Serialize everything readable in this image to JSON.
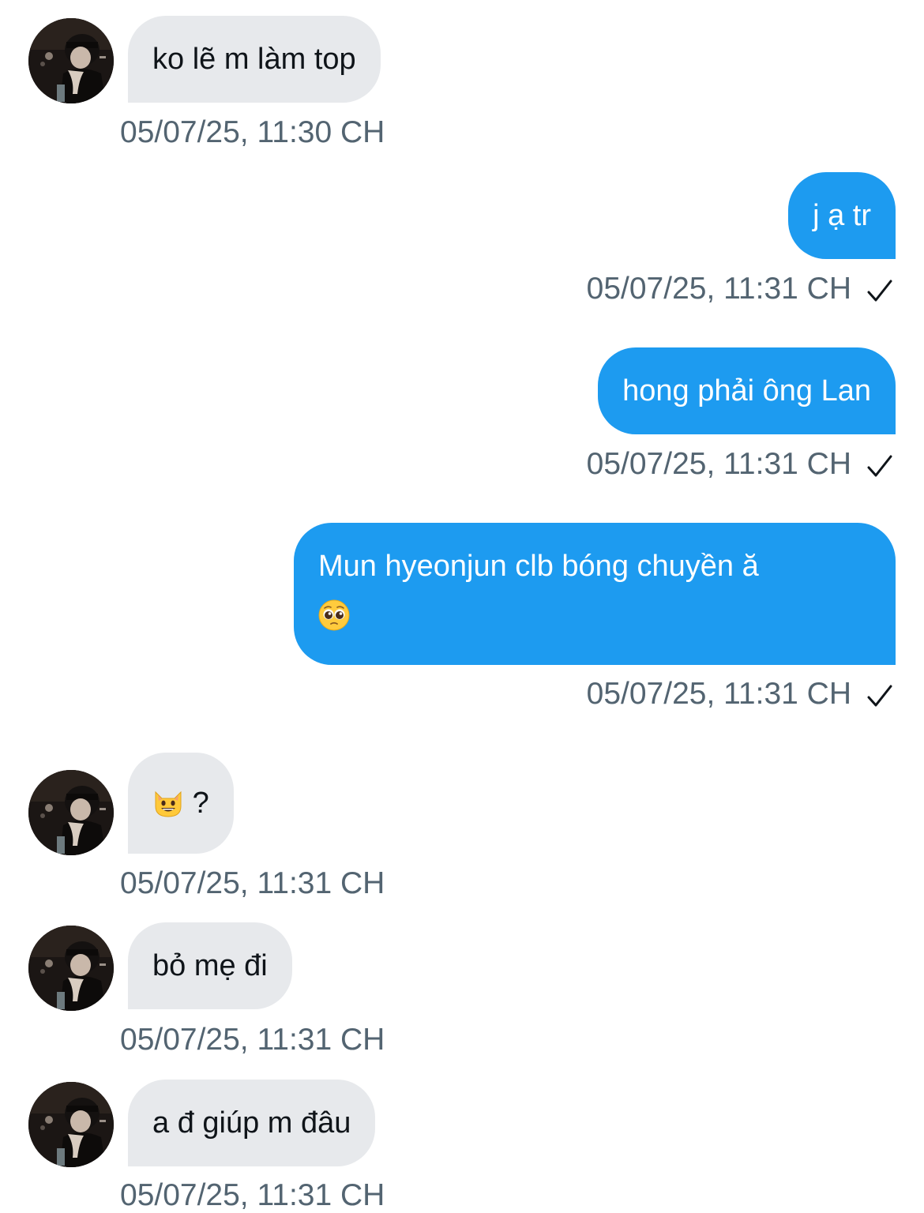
{
  "theme": {
    "incoming_bubble": "#e7e9ec",
    "outgoing_bubble": "#1d9bf0",
    "timestamp_color": "#536471"
  },
  "messages": [
    {
      "direction": "incoming",
      "text": "ko lẽ m làm top",
      "time": "05/07/25, 11:30 CH",
      "avatar": "user-avatar"
    },
    {
      "direction": "outgoing",
      "text": "j ạ tr",
      "time": "05/07/25, 11:31 CH",
      "status_icon": "check-icon"
    },
    {
      "direction": "outgoing",
      "text": "hong phải ông Lan",
      "time": "05/07/25, 11:31 CH",
      "status_icon": "check-icon"
    },
    {
      "direction": "outgoing",
      "text": "Mun hyeonjun clb bóng chuyền ă",
      "emoji": "pleading-face-emoji",
      "time": "05/07/25, 11:31 CH",
      "status_icon": "check-icon"
    },
    {
      "direction": "incoming",
      "emoji": "grinning-cat-emoji",
      "text": "?",
      "time": "05/07/25, 11:31 CH",
      "avatar": "user-avatar"
    },
    {
      "direction": "incoming",
      "text": "bỏ mẹ đi",
      "time": "05/07/25, 11:31 CH",
      "avatar": "user-avatar"
    },
    {
      "direction": "incoming",
      "text": "a đ giúp m đâu",
      "time": "05/07/25, 11:31 CH",
      "avatar": "user-avatar"
    }
  ]
}
